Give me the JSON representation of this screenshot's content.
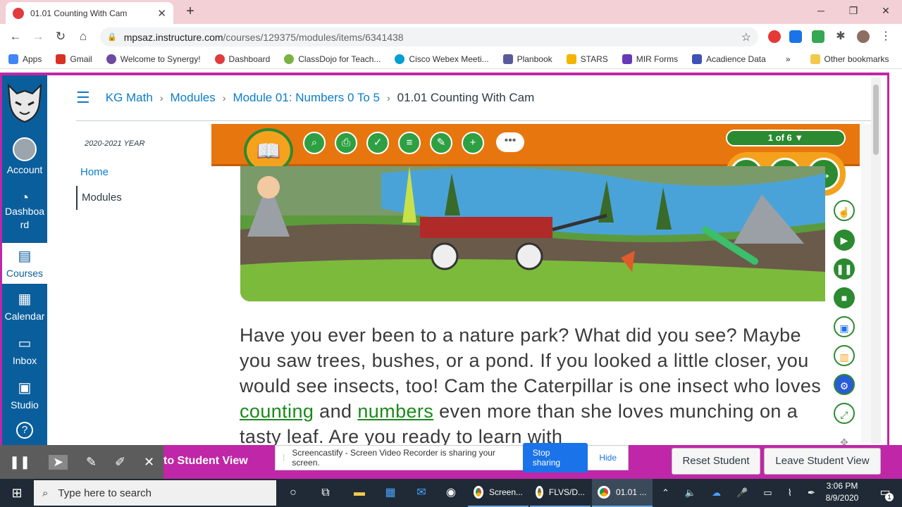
{
  "browser": {
    "tab_title": "01.01 Counting With Cam",
    "new_tab": "+",
    "url_host": "mpsaz.instructure.com",
    "url_path": "/courses/129375/modules/items/6341438",
    "bookmarks": [
      {
        "label": "Apps",
        "color": "#4285f4"
      },
      {
        "label": "Gmail",
        "color": "#d93025"
      },
      {
        "label": "Welcome to Synergy!",
        "color": "#6d4aa0"
      },
      {
        "label": "Dashboard",
        "color": "#e03c3c"
      },
      {
        "label": "ClassDojo for Teach...",
        "color": "#7bb342"
      },
      {
        "label": "Cisco Webex Meeti...",
        "color": "#00a0d1"
      },
      {
        "label": "Planbook",
        "color": "#5a5a9a"
      },
      {
        "label": "STARS",
        "color": "#f4b400"
      },
      {
        "label": "MIR Forms",
        "color": "#673ab7"
      },
      {
        "label": "Acadience Data",
        "color": "#3f51b5"
      }
    ],
    "more": "»",
    "other_bookmarks": "Other bookmarks"
  },
  "global_nav": {
    "account": "Account",
    "dashboard": "Dashboa rd",
    "courses": "Courses",
    "calendar": "Calendar",
    "inbox": "Inbox",
    "studio": "Studio",
    "help": "?"
  },
  "breadcrumb": {
    "course": "KG Math",
    "modules": "Modules",
    "module": "Module 01: Numbers 0 To 5",
    "current": "01.01 Counting With Cam"
  },
  "course_nav": {
    "year": "2020-2021 YEAR",
    "home": "Home",
    "modules": "Modules"
  },
  "lesson": {
    "page_count": "1 of 6 ▼",
    "text_1": "Have you ever been to a nature park? What did you see? Maybe you saw trees, bushes, or a pond. If you looked a little closer, you would see insects, too! Cam the Caterpillar is one insect who loves ",
    "link_counting": "counting",
    "text_2": " and ",
    "link_numbers": "numbers",
    "text_3": " even more than she loves munching on a tasty leaf. Are you ready to learn with"
  },
  "student_view": {
    "label": "to Student View",
    "reset": "Reset Student",
    "leave": "Leave Student View"
  },
  "screencastify": {
    "message": "Screencastify - Screen Video Recorder is sharing your screen.",
    "stop": "Stop sharing",
    "hide": "Hide"
  },
  "taskbar": {
    "search_placeholder": "Type here to search",
    "apps": [
      "Screen...",
      "FLVS/D...",
      "01.01 ..."
    ],
    "time": "3:06 PM",
    "date": "8/9/2020",
    "notifications": "1"
  }
}
